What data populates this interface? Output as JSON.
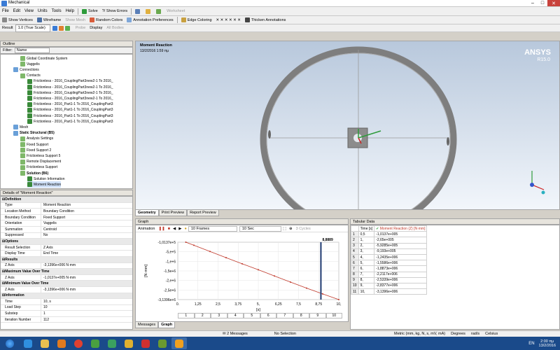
{
  "window": {
    "title": "Mechanical",
    "btn_min": "–",
    "btn_max": "□",
    "btn_close": "✕"
  },
  "menu": [
    "File",
    "Edit",
    "View",
    "Units",
    "Tools",
    "Help"
  ],
  "toolbar1": {
    "solve": "Solve",
    "show_errors": "?/ Show Errors",
    "worksheet": "Worksheet"
  },
  "toolbar2": {
    "show_vertices": "Show Vertices",
    "wireframe": "Wireframe",
    "show_mesh": "Show Mesh",
    "random_colors": "Random Colors",
    "annotation_prefs": "Annotation Preferences",
    "edge_coloring": "Edge Coloring",
    "thicken": "Thicken Annotations"
  },
  "toolbar3": {
    "result_label": "Result",
    "result_scale": "1.0 (True Scale)",
    "probe": "Probe",
    "display": "Display",
    "all_bodies": "All Bodies"
  },
  "outline": {
    "title": "Outline",
    "filter_label": "Filter:",
    "filter_value": "Name",
    "items": [
      {
        "label": "Global Coordinate System",
        "lvl": 2
      },
      {
        "label": "Vaggelis",
        "lvl": 2
      },
      {
        "label": "Connections",
        "lvl": 1
      },
      {
        "label": "Contacts",
        "lvl": 2
      },
      {
        "label": "Frictionless - 2016_CouplingPart3new2-1 To 2016_",
        "lvl": 3
      },
      {
        "label": "Frictionless - 2016_CouplingPart3new2-1 To 2016_",
        "lvl": 3
      },
      {
        "label": "Frictionless - 2016_CouplingPart3new2-1 To 2016_",
        "lvl": 3
      },
      {
        "label": "Frictionless - 2016_CouplingPart3new2-1 To 2016_",
        "lvl": 3
      },
      {
        "label": "Frictionless - 2016_Part1-1 To 2016_CouplingPart3",
        "lvl": 3
      },
      {
        "label": "Frictionless - 2016_Part1-1 To 2016_CouplingPart3",
        "lvl": 3
      },
      {
        "label": "Frictionless - 2016_Part1-1 To 2016_CouplingPart3",
        "lvl": 3
      },
      {
        "label": "Frictionless - 2016_Part1-1 To 2016_CouplingPart3",
        "lvl": 3
      },
      {
        "label": "Mesh",
        "lvl": 1
      },
      {
        "label": "Static Structural (B5)",
        "lvl": 1,
        "bold": true
      },
      {
        "label": "Analysis Settings",
        "lvl": 2
      },
      {
        "label": "Fixed Support",
        "lvl": 2
      },
      {
        "label": "Fixed Support 2",
        "lvl": 2
      },
      {
        "label": "Frictionless Support 5",
        "lvl": 2
      },
      {
        "label": "Remote Displacement",
        "lvl": 2
      },
      {
        "label": "Frictionless Support",
        "lvl": 2
      },
      {
        "label": "Solution (B6)",
        "lvl": 2,
        "bold": true
      },
      {
        "label": "Solution Information",
        "lvl": 3
      },
      {
        "label": "Moment Reaction",
        "lvl": 3
      }
    ]
  },
  "details": {
    "title": "Details of \"Moment Reaction\"",
    "rows": [
      {
        "g": "Definition"
      },
      {
        "k": "Type",
        "v": "Moment Reaction"
      },
      {
        "k": "Location Method",
        "v": "Boundary Condition"
      },
      {
        "k": "Boundary Condition",
        "v": "Fixed Support"
      },
      {
        "k": "Orientation",
        "v": "Vaggelis"
      },
      {
        "k": "Summation",
        "v": "Centroid"
      },
      {
        "k": "Suppressed",
        "v": "No"
      },
      {
        "g": "Options"
      },
      {
        "k": "Result Selection",
        "v": "Z Axis"
      },
      {
        "k": "Display Time",
        "v": "End Time"
      },
      {
        "g": "Results"
      },
      {
        "k": "Z Axis",
        "v": "-3,1396e+006 N·mm"
      },
      {
        "g": "Maximum Value Over Time"
      },
      {
        "k": "Z Axis",
        "v": "-1,0137e+005 N·mm"
      },
      {
        "g": "Minimum Value Over Time"
      },
      {
        "k": "Z Axis",
        "v": "-3,1396e+006 N·mm"
      },
      {
        "g": "Information"
      },
      {
        "k": "Time",
        "v": "10, s"
      },
      {
        "k": "Load Step",
        "v": "10"
      },
      {
        "k": "Substep",
        "v": "1"
      },
      {
        "k": "Iteration Number",
        "v": "112"
      }
    ]
  },
  "viewport": {
    "result_title": "Moment Reaction",
    "date": "13/2/2016 1:59 πμ",
    "brand": "ANSYS",
    "version": "R15.0",
    "tabs": [
      "Geometry",
      "Print Preview",
      "Report Preview"
    ]
  },
  "graph": {
    "title": "Graph",
    "animation": "Animation",
    "frames": "10 Frames",
    "duration": "10 Sec",
    "cycles": "3 Cycles",
    "bottom_tabs": [
      "Messages",
      "Graph"
    ]
  },
  "tabular": {
    "title": "Tabular Data",
    "col_time": "Time [s]",
    "col_val": "Moment Reaction (Z) [N·mm]",
    "rows": [
      [
        "1",
        "0,5",
        "-1,0137e+005"
      ],
      [
        "2",
        "1,",
        "-2,65e+005"
      ],
      [
        "3",
        "2,",
        "-5,9285e+005"
      ],
      [
        "4",
        "3,",
        "-9,193e+005"
      ],
      [
        "5",
        "4,",
        "-1,2435e+006"
      ],
      [
        "6",
        "5,",
        "-1,5586e+006"
      ],
      [
        "7",
        "6,",
        "-1,8873e+006"
      ],
      [
        "8",
        "7,",
        "-2,2117e+006"
      ],
      [
        "9",
        "8,",
        "-2,5339e+006"
      ],
      [
        "10",
        "9,",
        "-2,8377e+006"
      ],
      [
        "11",
        "10,",
        "-3,1396e+006"
      ]
    ]
  },
  "chart_data": {
    "type": "line",
    "x": [
      0.5,
      1,
      2,
      3,
      4,
      5,
      6,
      7,
      8,
      9,
      10
    ],
    "y": [
      -101370,
      -265000,
      -592850,
      -919300,
      -1243500,
      -1558600,
      -1887300,
      -2211700,
      -2533900,
      -2837700,
      -3139600
    ],
    "xlabel": "[s]",
    "ylabel": "[N·mm]",
    "xlim": [
      0,
      10
    ],
    "ylim": [
      -3139600,
      -101370
    ],
    "xticks": [
      "0.",
      "1,25",
      "2,5",
      "3,75",
      "5,",
      "6,25",
      "7,5",
      "8,75",
      "10,"
    ],
    "yticks": [
      "-1,0137e+5",
      "-5,e+5",
      "-1,e+6",
      "-1,5e+6",
      "-2,e+6",
      "-2,5e+6",
      "-3,1396e+6"
    ],
    "cursor_x": 8.8889,
    "cursor_label": "8,8889",
    "cells": [
      "1",
      "2",
      "3",
      "4",
      "5",
      "6",
      "7",
      "8",
      "9",
      "10"
    ],
    "line_color": "#c0392b",
    "grid": true
  },
  "status": {
    "messages": "2 Messages",
    "selection": "No Selection",
    "units": "Metric (mm, kg, N, s, mV, mA)",
    "degrees": "Degrees",
    "rad": "rad/s",
    "celsius": "Celsius"
  },
  "taskbar": {
    "lang": "EN",
    "time": "2:00 πμ",
    "date": "13/2/2016"
  }
}
